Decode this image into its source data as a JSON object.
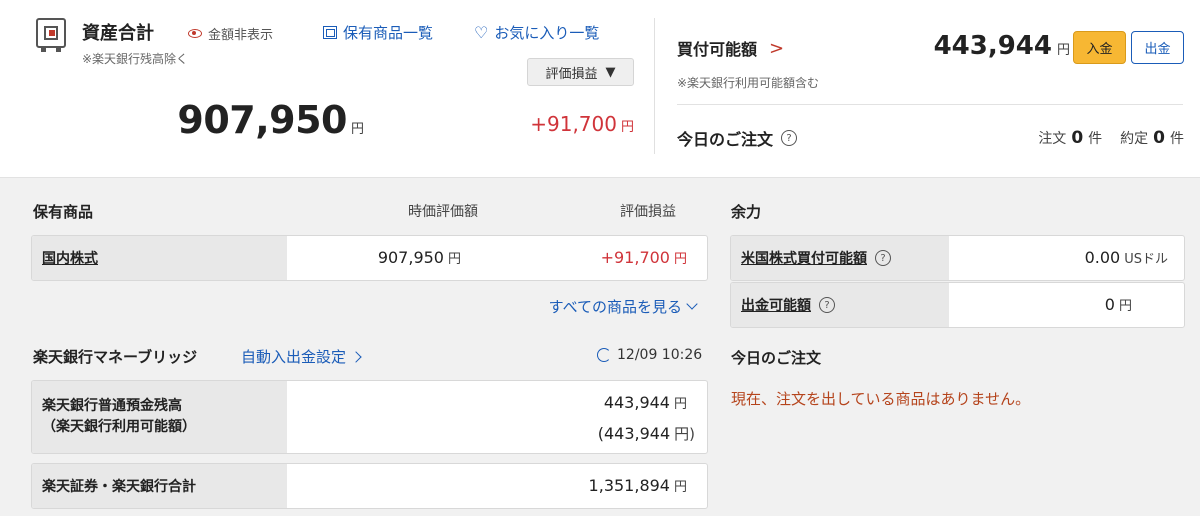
{
  "assets": {
    "title": "資産合計",
    "hide_label": "金額非表示",
    "note": "※楽天銀行残高除く",
    "holdings_link": "保有商品一覧",
    "favorites_link": "お気に入り一覧",
    "eval_select": "評価損益",
    "total": "907,950",
    "total_unit": "円",
    "profit": "+91,700",
    "profit_unit": "円"
  },
  "buying": {
    "title": "買付可能額",
    "value": "443,944",
    "unit": "円",
    "deposit_button": "入金",
    "withdraw_button": "出金",
    "note": "※楽天銀行利用可能額含む"
  },
  "today_orders": {
    "title": "今日のご注文",
    "order_label": "注文",
    "order_count": "0",
    "count_unit": "件",
    "executed_label": "約定",
    "executed_count": "0",
    "executed_unit": "件"
  },
  "holdings": {
    "title": "保有商品",
    "col_market_value": "時価評価額",
    "col_profit": "評価損益",
    "rows": [
      {
        "label": "国内株式",
        "value": "907,950",
        "unit": "円",
        "profit": "+91,700",
        "profit_unit": "円"
      }
    ],
    "see_all": "すべての商品を見る"
  },
  "capacity": {
    "title": "余力",
    "rows": [
      {
        "label": "米国株式買付可能額",
        "value": "0.00",
        "unit": "USドル"
      },
      {
        "label": "出金可能額",
        "value": "0",
        "unit": "円"
      }
    ]
  },
  "bridge": {
    "title": "楽天銀行マネーブリッジ",
    "auto_link": "自動入出金設定",
    "updated": "12/09 10:26",
    "balance_label_1": "楽天銀行普通預金残高",
    "balance_label_2": "（楽天銀行利用可能額）",
    "balance": "443,944",
    "balance_unit": "円",
    "available": "(443,944",
    "available_unit": "円)",
    "total_label": "楽天証券・楽天銀行合計",
    "total": "1,351,894",
    "total_unit": "円"
  },
  "today_orders_panel": {
    "title": "今日のご注文",
    "message": "現在、注文を出している商品はありません。"
  },
  "colors": {
    "accent_link": "#1a5cb8",
    "profit_red": "#d0343a",
    "deposit_orange": "#f7b733",
    "message_brown": "#b5441c"
  }
}
